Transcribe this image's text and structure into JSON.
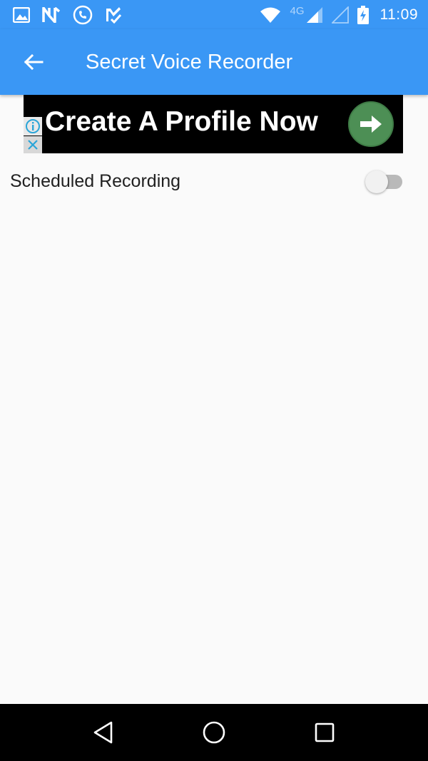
{
  "status_bar": {
    "network_label": "4G",
    "time": "11:09",
    "icons": [
      "gallery-icon",
      "n-app-icon",
      "phone-sync-icon",
      "task-check-icon",
      "wifi-icon",
      "cell-signal-icon",
      "cell-signal-empty-icon",
      "battery-charging-icon"
    ]
  },
  "app_bar": {
    "title": "Secret Voice Recorder",
    "back_icon": "arrow-left-icon"
  },
  "ad": {
    "headline": "Create A Profile Now",
    "cta_icon": "arrow-right-icon",
    "info_icon": "info-icon",
    "close_icon": "close-icon"
  },
  "settings": {
    "scheduled_recording_label": "Scheduled Recording",
    "scheduled_recording_enabled": false
  },
  "nav_bar": {
    "icons": [
      "back-triangle-icon",
      "home-circle-icon",
      "recents-square-icon"
    ]
  },
  "colors": {
    "primary": "#3a97f5",
    "ad_cta": "#4d8f55",
    "background": "#fafafa"
  }
}
